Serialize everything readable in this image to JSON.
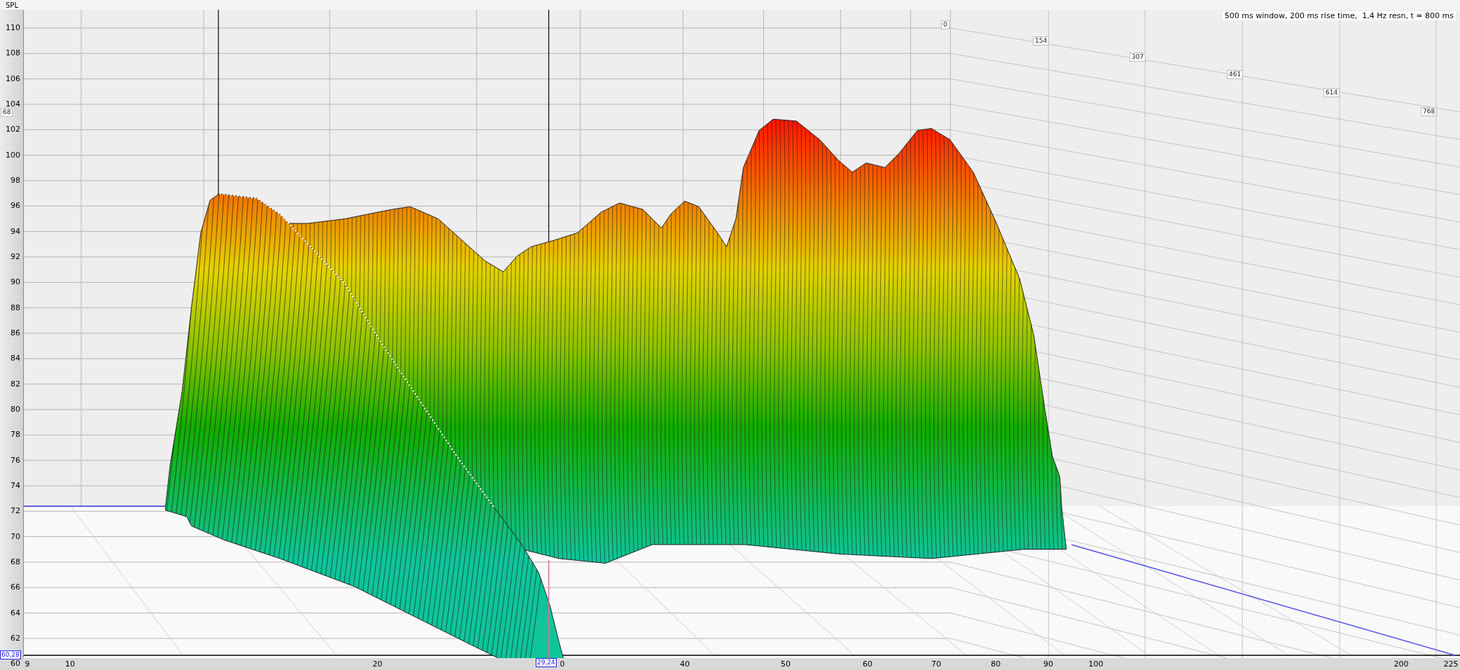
{
  "y_axis": {
    "title": "SPL",
    "ticks": [
      "110",
      "108",
      "106",
      "104",
      "102",
      "100",
      "98",
      "96",
      "94",
      "92",
      "90",
      "88",
      "86",
      "84",
      "82",
      "80",
      "78",
      "76",
      "74",
      "72",
      "70",
      "68",
      "66",
      "64",
      "62",
      "60"
    ]
  },
  "x_axis": {
    "ticks": [
      "9",
      "10",
      "20",
      "0",
      "40",
      "50",
      "60",
      "70",
      "80",
      "90",
      "100",
      "200",
      "225"
    ]
  },
  "time_labels": [
    "68",
    "0",
    "154",
    "307",
    "461",
    "614",
    "768"
  ],
  "info": "500 ms window, 200 ms rise time,  1,4 Hz resn, t = 800 ms",
  "cursor": {
    "spl": "60,28",
    "freq": "29,24"
  }
}
